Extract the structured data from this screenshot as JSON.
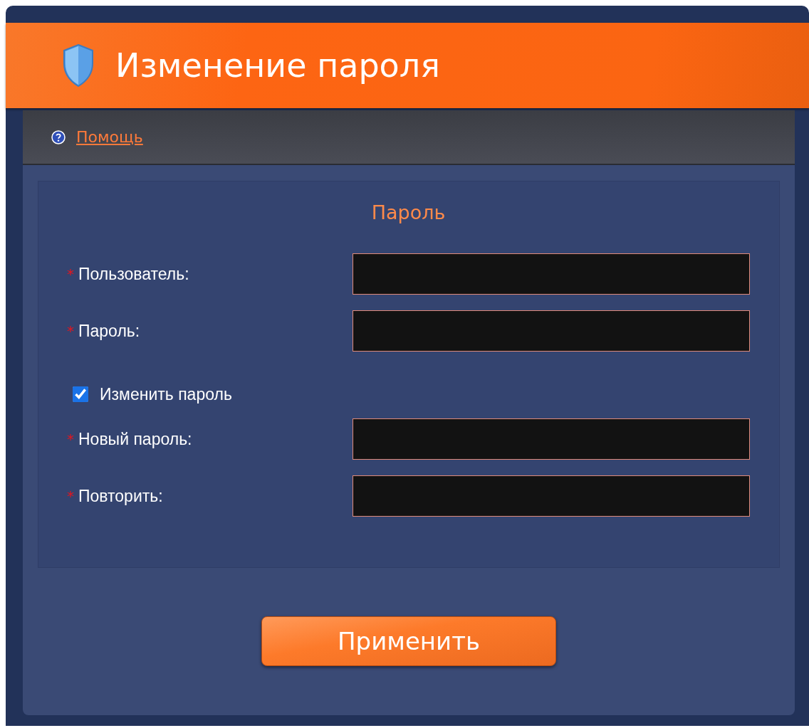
{
  "window": {
    "title": "Изменение пароля"
  },
  "help_link": {
    "label": "Помощь"
  },
  "section": {
    "title": "Пароль",
    "fields": [
      {
        "kind": "input",
        "required_mark": "*",
        "label": "Пользователь:"
      },
      {
        "kind": "input",
        "required_mark": "*",
        "label": "Пароль:"
      },
      {
        "kind": "checkbox",
        "label": "Изменить пароль",
        "checked": true
      },
      {
        "kind": "input",
        "required_mark": "*",
        "label": "Новый пароль:"
      },
      {
        "kind": "input",
        "required_mark": "*",
        "label": "Повторить:"
      }
    ]
  },
  "buttons": [
    "Применить"
  ]
}
